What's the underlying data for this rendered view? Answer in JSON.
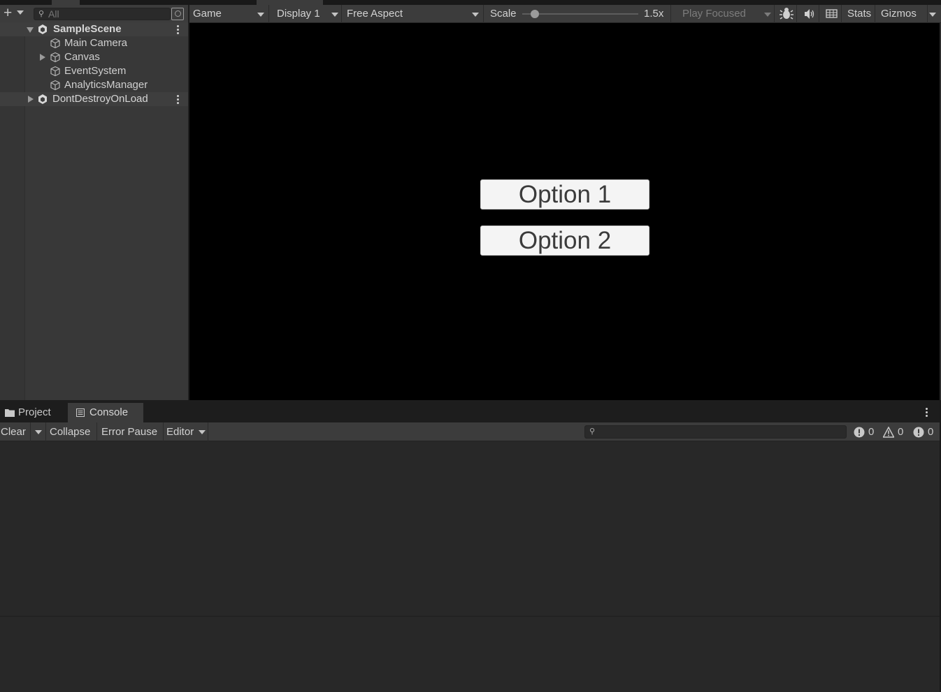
{
  "hierarchy": {
    "search": {
      "placeholder": "All"
    },
    "rows": [
      {
        "label": "SampleScene",
        "kind": "scene",
        "expanded": true
      },
      {
        "label": "Main Camera",
        "kind": "gameobject"
      },
      {
        "label": "Canvas",
        "kind": "gameobject",
        "collapsed_children": true
      },
      {
        "label": "EventSystem",
        "kind": "gameobject"
      },
      {
        "label": "AnalyticsManager",
        "kind": "gameobject"
      },
      {
        "label": "DontDestroyOnLoad",
        "kind": "scene",
        "expanded": false
      }
    ]
  },
  "game_toolbar": {
    "view_mode": "Game",
    "display": "Display 1",
    "aspect": "Free Aspect",
    "scale_label": "Scale",
    "scale_value": "1.5x",
    "scale_level": 0.11,
    "play_mode": "Play Focused",
    "stats": "Stats",
    "gizmos": "Gizmos",
    "icons": [
      "bug-icon",
      "audio-mute-icon",
      "resolution-grid-icon"
    ]
  },
  "game_canvas": {
    "buttons": [
      {
        "label": "Option 1"
      },
      {
        "label": "Option 2"
      }
    ]
  },
  "console": {
    "tabs": [
      {
        "label": "Project",
        "icon": "folder-icon",
        "active": false
      },
      {
        "label": "Console",
        "icon": "console-icon",
        "active": true
      }
    ],
    "toolbar": {
      "clear": "Clear",
      "collapse": "Collapse",
      "error_pause": "Error Pause",
      "editor": "Editor"
    },
    "search": {
      "value": ""
    },
    "counts": {
      "errors": "0",
      "warnings": "0",
      "messages": "0"
    }
  },
  "colors": {
    "panel_bg": "#383838",
    "toolbar_bg": "#3c3c3c",
    "game_bg": "#000000",
    "button_bg": "#f4f4f4"
  }
}
